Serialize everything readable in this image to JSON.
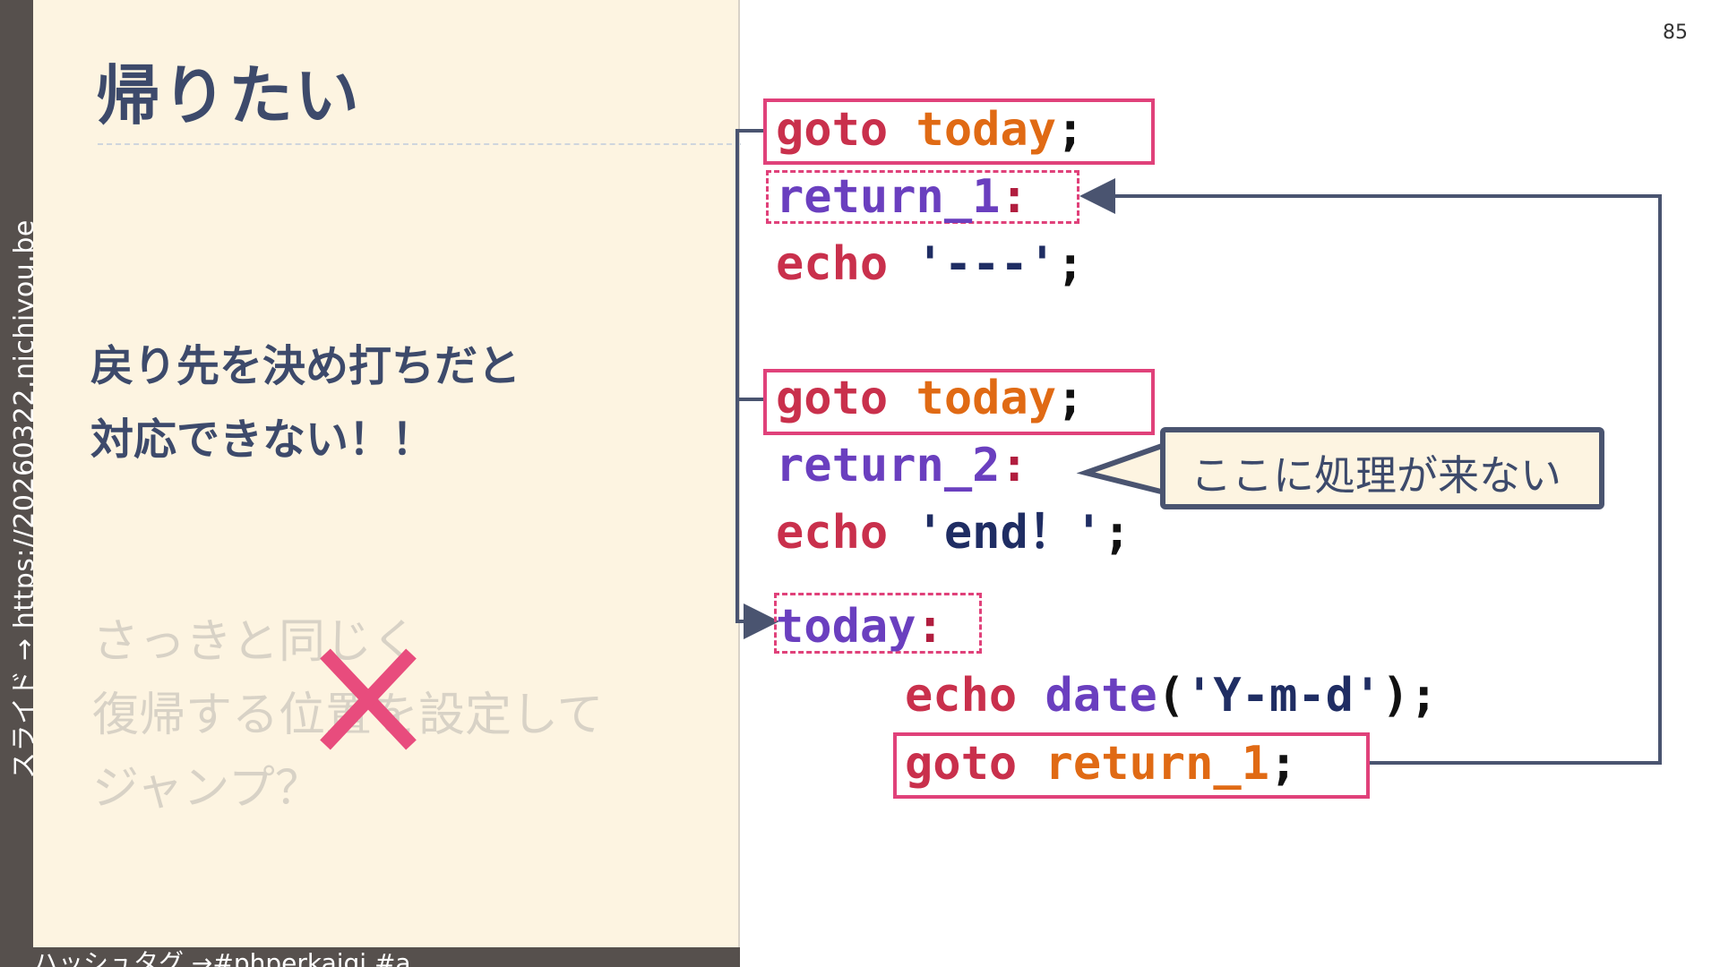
{
  "side_text": "スライド → https://20260322.nichiyou.be",
  "hashtag": "ハッシュタグ →#phperkaigi #a",
  "page_number": "85",
  "title": "帰りたい",
  "main_message": [
    "戻り先を決め打ちだと",
    "対応できない！！"
  ],
  "faded_message": [
    "さっきと同じく",
    "復帰する位置を設定して",
    "ジャンプ？"
  ],
  "code": {
    "line1": {
      "kw": "goto",
      "target": "today",
      "end": ";"
    },
    "line2": {
      "label": "return_1",
      "colon": ":"
    },
    "line3": {
      "kw": "echo",
      "str": "'---'",
      "end": ";"
    },
    "line4": {
      "kw": "goto",
      "target": "today",
      "end": ";"
    },
    "line5": {
      "label": "return_2",
      "colon": ":"
    },
    "line6": {
      "kw": "echo",
      "str": "'end！'",
      "end": ";"
    },
    "line7": {
      "label": "today",
      "colon": ":"
    },
    "line8": {
      "kw": "echo",
      "func": "date",
      "open": "(",
      "str": "'Y-m-d'",
      "close": ")",
      "end": ";"
    },
    "line9": {
      "kw": "goto",
      "target": "return_1",
      "end": ";"
    }
  },
  "callout": "ここに処理が来ない",
  "colors": {
    "accent_pink": "#e0417a",
    "navy": "#3d4a6b",
    "panel_bg": "#fdf4e1"
  }
}
